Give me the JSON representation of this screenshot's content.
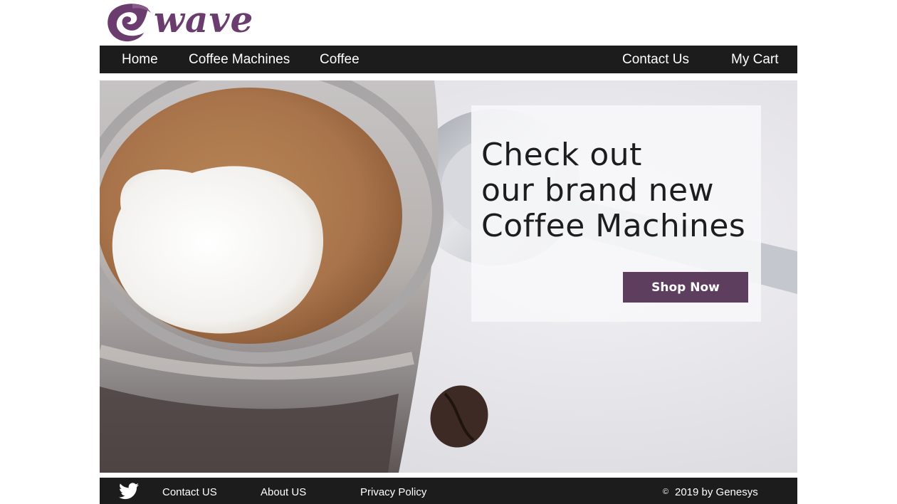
{
  "brand": {
    "logo_text": "wave",
    "logo_icon": "wave-swirl-icon",
    "accent": "#6b3d6e"
  },
  "nav": {
    "items": [
      {
        "label": "Home"
      },
      {
        "label": "Coffee Machines"
      },
      {
        "label": "Coffee"
      },
      {
        "label": "Contact Us"
      },
      {
        "label": "My Cart"
      }
    ]
  },
  "hero": {
    "image": "coffee-glass-photo",
    "promo_lines": [
      "Check out",
      "our brand new",
      "Coffee Machines"
    ],
    "cta_label": "Shop Now",
    "cta_color": "#5e3e5f"
  },
  "footer": {
    "social_icon": "twitter-icon",
    "links": [
      {
        "label": "Contact US"
      },
      {
        "label": "About US"
      },
      {
        "label": "Privacy Policy"
      }
    ],
    "copyright_symbol": "©",
    "copyright_text": "2019 by Genesys"
  }
}
